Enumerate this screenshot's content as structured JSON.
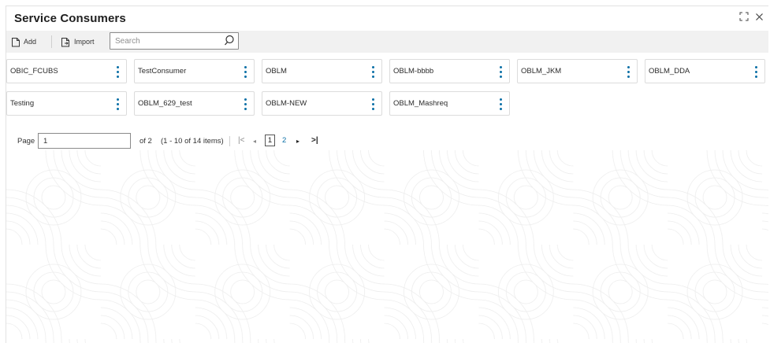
{
  "header": {
    "title": "Service Consumers",
    "icons": [
      "expand-icon",
      "close-icon"
    ]
  },
  "toolbar": {
    "add_label": "Add",
    "import_label": "Import",
    "search_placeholder": "Search"
  },
  "cards": [
    {
      "label": "OBIC_FCUBS"
    },
    {
      "label": "TestConsumer"
    },
    {
      "label": "OBLM"
    },
    {
      "label": "OBLM-bbbb"
    },
    {
      "label": "OBLM_JKM"
    },
    {
      "label": "OBLM_DDA"
    },
    {
      "label": "Testing"
    },
    {
      "label": "OBLM_629_test"
    },
    {
      "label": "OBLM-NEW"
    },
    {
      "label": "OBLM_Mashreq"
    }
  ],
  "pagination": {
    "page_label": "Page",
    "page_value": "1",
    "of_text": "of 2",
    "items_text": "(1 - 10 of 14 items)",
    "current_page": "1",
    "next_page": "2",
    "first_icon": "|<",
    "prev_icon": "◂",
    "next_icon": "▸",
    "last_icon": ">|"
  },
  "colors": {
    "accent": "#0a6fa6",
    "toolbar_bg": "#f1f1f1",
    "card_border": "#dcdcdc"
  }
}
